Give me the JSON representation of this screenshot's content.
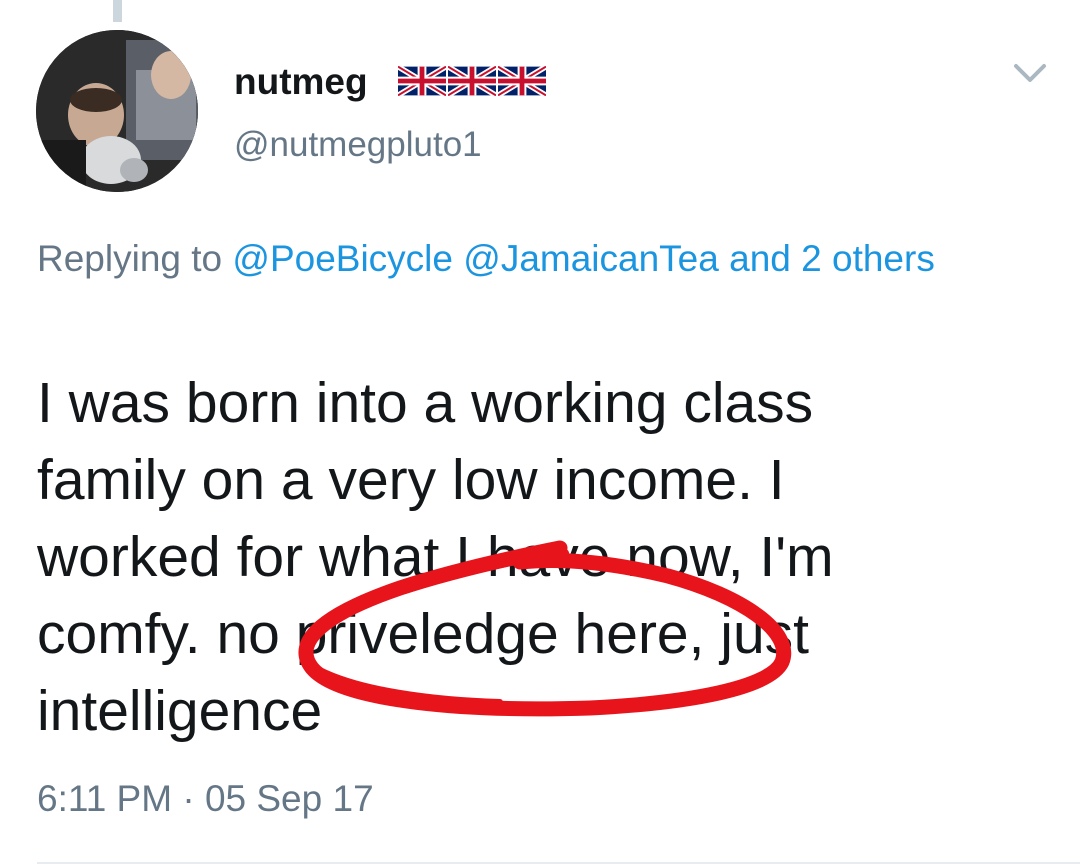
{
  "tweet": {
    "author": {
      "display_name": "nutmeg",
      "flags": [
        "uk-flag-icon",
        "uk-flag-icon",
        "uk-flag-icon"
      ],
      "handle": "@nutmegpluto1"
    },
    "reply_context": {
      "prefix": "Replying to",
      "mention_1": "@PoeBicycle",
      "mention_2": "@JamaicanTea",
      "others_link": "and 2 others"
    },
    "text_lines": [
      "I was born into a working class",
      "family on a very low income. I",
      "worked for what I have now, I'm",
      "comfy. no priveledge here, just",
      "intelligence"
    ],
    "time": "6:11 PM",
    "separator": "·",
    "date": "05 Sep 17",
    "menu_icon": "chevron-down-icon"
  },
  "colors": {
    "link": "#1b95e0",
    "secondary_text": "#657786",
    "primary_text": "#14171a",
    "annotation": "#e8141c"
  }
}
